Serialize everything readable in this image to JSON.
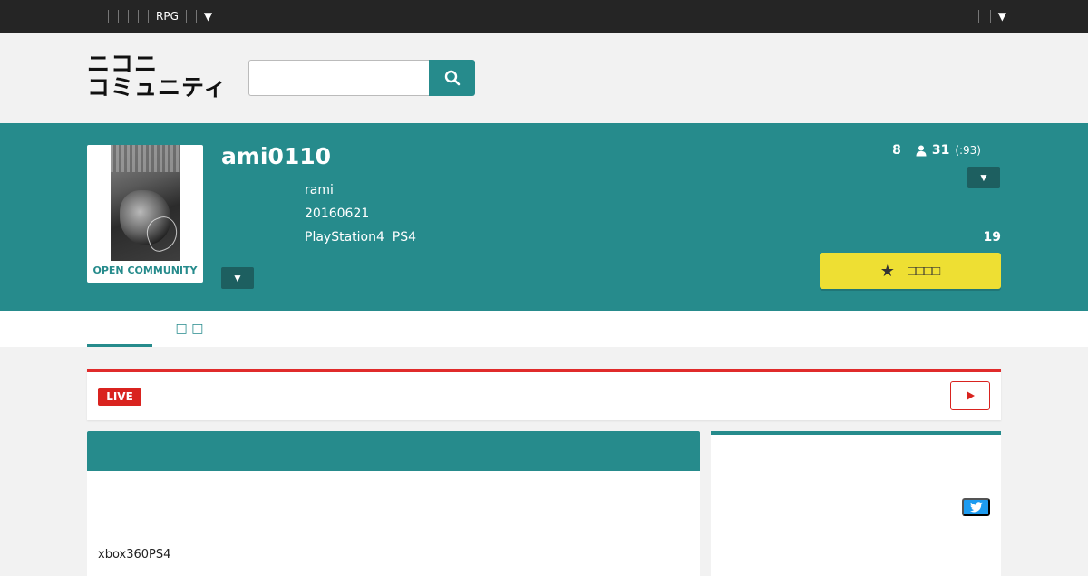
{
  "topbar": {
    "nav_label": "RPG",
    "nav_caret": "▼",
    "right_caret": "▼"
  },
  "header": {
    "logo_line1": "ニコニ",
    "logo_line2": "コミュニティ",
    "search_placeholder": ""
  },
  "community": {
    "name": "ami0110",
    "owner": "rami",
    "created": "20160621",
    "tags": "PlayStation4  PS4",
    "open_badge": "OPEN COMMUNITY",
    "toggle_caret": "▼",
    "level": "8",
    "members": "31",
    "member_cap": "(:93)",
    "right_caret": "▼",
    "follow_count": "19",
    "follow_label": "□□□□"
  },
  "tabs": [
    {
      "label": ""
    },
    {
      "label": "□ □"
    }
  ],
  "live": {
    "badge": "LIVE"
  },
  "main": {
    "text": "xbox360PS4"
  },
  "colors": {
    "teal": "#268b8c",
    "live_red": "#d9231f",
    "follow_yellow": "#eedf33",
    "twitter_blue": "#1d9bf0"
  }
}
